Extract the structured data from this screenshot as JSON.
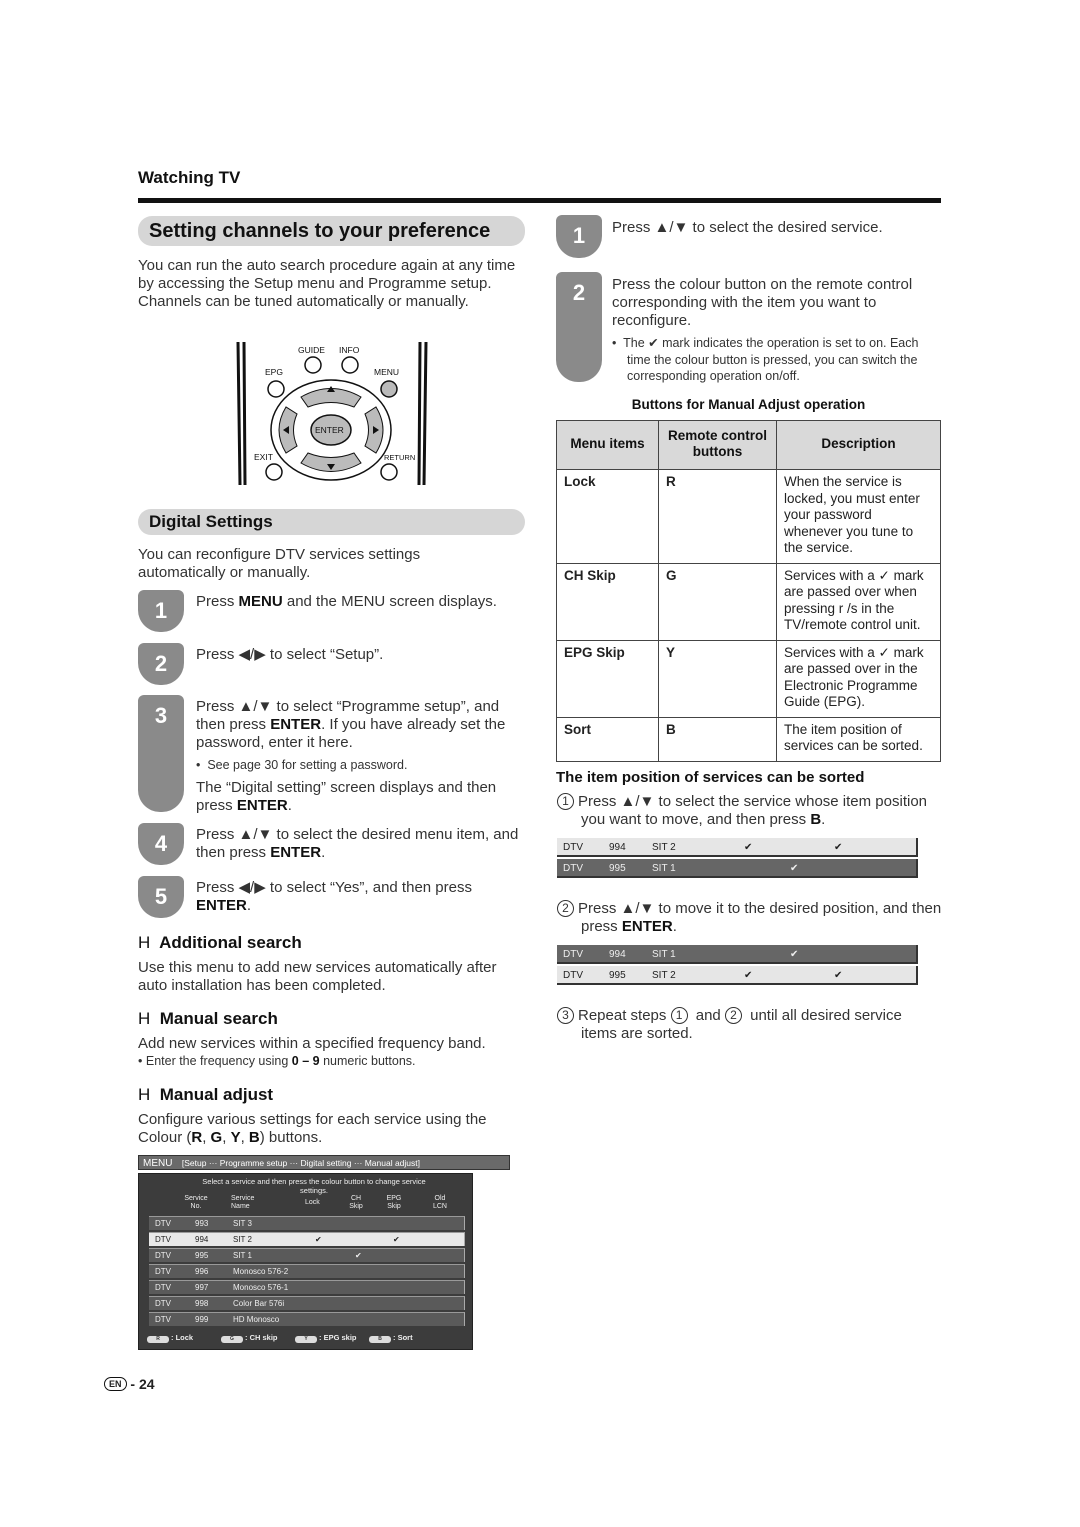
{
  "section": "Watching TV",
  "title": "Setting channels to your preference",
  "intro": "You can run the auto search procedure again at any time by accessing the Setup menu and Programme setup. Channels can be tuned automatically or manually.",
  "remote": {
    "guide": "GUIDE",
    "info": "INFO",
    "epg": "EPG",
    "menu": "MENU",
    "enter": "ENTER",
    "exit": "EXIT",
    "return": "RETURN"
  },
  "digital": {
    "title": "Digital Settings",
    "intro": "You can reconfigure DTV services settings automatically or manually.",
    "steps": [
      {
        "num": "1",
        "a": "Press ",
        "b": "MENU",
        "c": " and the MENU screen displays."
      },
      {
        "num": "2",
        "a": "Press ◀/▶ to select “Setup”."
      },
      {
        "num": "3",
        "a": "Press ▲/▼ to select “Programme setup”, and then press ",
        "b": "ENTER",
        "c": ". If you have already set the password, enter it here.",
        "note": "See page 30 for setting a password.",
        "d": "The “Digital setting” screen displays and then press ",
        "e": "ENTER",
        "f": "."
      },
      {
        "num": "4",
        "a": "Press ▲/▼ to select the desired menu item, and then press ",
        "b": "ENTER",
        "c": "."
      },
      {
        "num": "5",
        "a": "Press ◀/▶ to select “Yes”, and then press ",
        "b": "ENTER",
        "c": "."
      }
    ]
  },
  "additional": {
    "marker": "H",
    "title": "Additional search",
    "text": "Use this menu to add new services automatically after auto installation has been completed."
  },
  "manual_search": {
    "marker": "H",
    "title": "Manual search",
    "text": "Add new services within a specified frequency band.",
    "note_a": "Enter the frequency using ",
    "note_b": "0 – 9",
    "note_c": " numeric buttons."
  },
  "manual_adjust": {
    "marker": "H",
    "title": "Manual adjust",
    "text_a": "Configure various settings for each service using the Colour (",
    "R": "R",
    "G": "G",
    "Y": "Y",
    "B": "B",
    "text_b": ") buttons."
  },
  "screen": {
    "menu": "MENU",
    "path": "[Setup ··· Programme setup ··· Digital setting ··· Manual adjust]",
    "instruction": "Select a service and then press the colour button to change service settings.",
    "columns": [
      "Service No.",
      "Service Name",
      "Lock",
      "CH Skip",
      "EPG Skip",
      "Old LCN"
    ],
    "rows": [
      {
        "type": "DTV",
        "no": "993",
        "name": "SIT 3",
        "lock": "",
        "ch": "",
        "epg": "",
        "selected": false
      },
      {
        "type": "DTV",
        "no": "994",
        "name": "SIT 2",
        "lock": "✔",
        "ch": "",
        "epg": "✔",
        "selected": true
      },
      {
        "type": "DTV",
        "no": "995",
        "name": "SIT 1",
        "lock": "",
        "ch": "✔",
        "epg": "",
        "selected": false
      },
      {
        "type": "DTV",
        "no": "996",
        "name": "Monosco 576-2",
        "lock": "",
        "ch": "",
        "epg": "",
        "selected": false
      },
      {
        "type": "DTV",
        "no": "997",
        "name": "Monosco 576-1",
        "lock": "",
        "ch": "",
        "epg": "",
        "selected": false
      },
      {
        "type": "DTV",
        "no": "998",
        "name": "Color Bar 576i",
        "lock": "",
        "ch": "",
        "epg": "",
        "selected": false
      },
      {
        "type": "DTV",
        "no": "999",
        "name": "HD Monosco",
        "lock": "",
        "ch": "",
        "epg": "",
        "selected": false
      }
    ],
    "legend": [
      {
        "key": "R",
        "label": ": Lock"
      },
      {
        "key": "G",
        "label": ": CH skip"
      },
      {
        "key": "Y",
        "label": ": EPG skip"
      },
      {
        "key": "B",
        "label": ": Sort"
      }
    ]
  },
  "right_steps": [
    {
      "num": "1",
      "a": "Press ▲/▼ to select the desired service."
    },
    {
      "num": "2",
      "a": "Press the colour button on the remote control corresponding with the item you want to reconfigure.",
      "note": "The ✔ mark indicates the operation is set to on. Each time the colour button is pressed, you can switch the corresponding operation on/off."
    }
  ],
  "buttons_table": {
    "caption": "Buttons for Manual Adjust operation",
    "headers": [
      "Menu items",
      "Remote control buttons",
      "Description"
    ],
    "rows": [
      [
        "Lock",
        "R",
        "When the service is locked, you must enter your password whenever you tune to the service."
      ],
      [
        "CH Skip",
        "G",
        "Services with a ✓ mark are passed over when pressing r   /s    in the TV/remote control unit."
      ],
      [
        "EPG Skip",
        "Y",
        "Services with a ✓ mark are passed over in the Electronic Programme Guide (EPG)."
      ],
      [
        "Sort",
        "B",
        "The item position of services can be sorted."
      ]
    ]
  },
  "sort": {
    "title": "The item position of services can be sorted",
    "s1": {
      "n": "1",
      "a": "Press ▲/▼ to select the service whose item position you want to move, and then press ",
      "b": "B",
      "c": "."
    },
    "rows1": [
      {
        "type": "DTV",
        "no": "994",
        "name": "SIT 2",
        "lock": "✔",
        "ch": "",
        "epg": "✔",
        "selected": true
      },
      {
        "type": "DTV",
        "no": "995",
        "name": "SIT 1",
        "lock": "",
        "ch": "✔",
        "epg": "",
        "selected": false
      }
    ],
    "s2": {
      "n": "2",
      "a": "Press ▲/▼ to move it to the desired position, and then press ",
      "b": "ENTER",
      "c": "."
    },
    "rows2": [
      {
        "type": "DTV",
        "no": "994",
        "name": "SIT 1",
        "lock": "",
        "ch": "✔",
        "epg": "",
        "selected": false
      },
      {
        "type": "DTV",
        "no": "995",
        "name": "SIT 2",
        "lock": "✔",
        "ch": "",
        "epg": "✔",
        "selected": true
      }
    ],
    "s3": {
      "n": "3",
      "a": "Repeat steps ",
      "c1": "1",
      "b": " and ",
      "c2": "2",
      "c": " until all desired service items are sorted."
    }
  },
  "footer": {
    "lang": "EN",
    "page": "24"
  }
}
